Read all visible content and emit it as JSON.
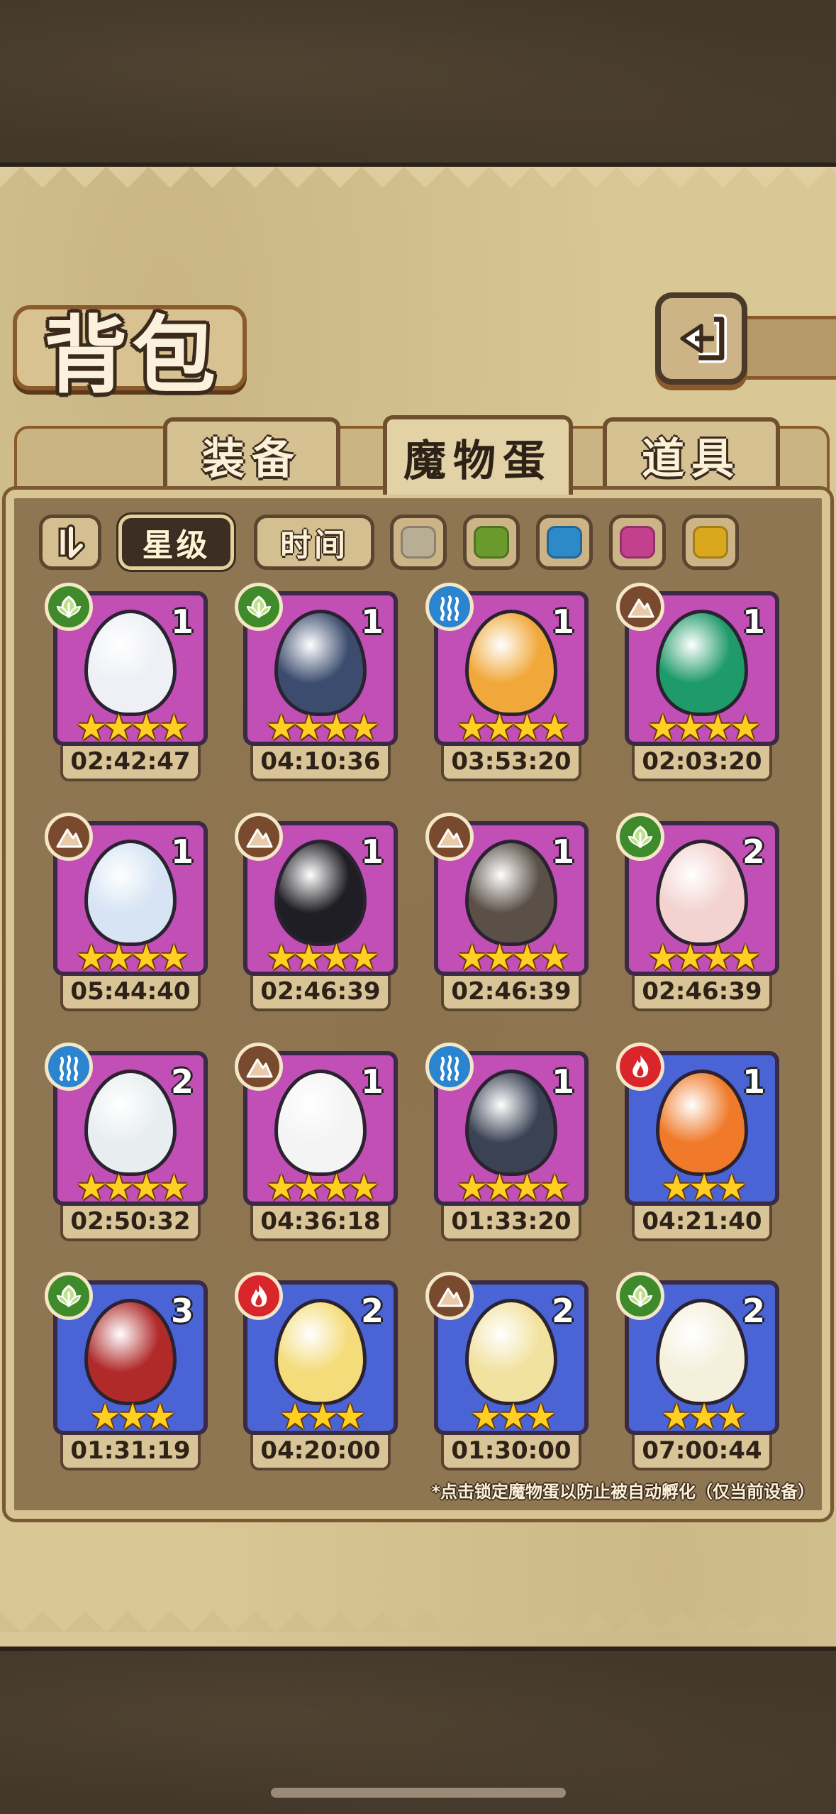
{
  "title": "背包",
  "tabs": [
    {
      "label": "装备",
      "active": false
    },
    {
      "label": "魔物蛋",
      "active": true
    },
    {
      "label": "道具",
      "active": false
    }
  ],
  "filters": {
    "sort_icon": "sort-toggle-icon",
    "star_label": "星级",
    "time_label": "时间",
    "color_swatches": [
      "#b8ad95",
      "#6a9a2c",
      "#2d8ac8",
      "#c2408e",
      "#d9a81c"
    ]
  },
  "elements": {
    "grass": {
      "icon": "leaf-icon",
      "color": "#3f8a2a"
    },
    "water": {
      "icon": "water-wave-icon",
      "color": "#2a84cf"
    },
    "earth": {
      "icon": "mountain-icon",
      "color": "#7a4a2e"
    },
    "fire": {
      "icon": "flame-icon",
      "color": "#d8262b"
    }
  },
  "eggs": [
    {
      "element": "grass",
      "count": "1",
      "stars": 4,
      "timer": "02:42:47",
      "rarity": "purple",
      "egg_color": "#eef0f6"
    },
    {
      "element": "grass",
      "count": "1",
      "stars": 4,
      "timer": "04:10:36",
      "rarity": "purple",
      "egg_color": "#3b4c6e"
    },
    {
      "element": "water",
      "count": "1",
      "stars": 4,
      "timer": "03:53:20",
      "rarity": "purple",
      "egg_color": "#f0a83a"
    },
    {
      "element": "earth",
      "count": "1",
      "stars": 4,
      "timer": "02:03:20",
      "rarity": "purple",
      "egg_color": "#1f9a6a"
    },
    {
      "element": "earth",
      "count": "1",
      "stars": 4,
      "timer": "05:44:40",
      "rarity": "purple",
      "egg_color": "#d6e4f4"
    },
    {
      "element": "earth",
      "count": "1",
      "stars": 4,
      "timer": "02:46:39",
      "rarity": "purple",
      "egg_color": "#1e1e24"
    },
    {
      "element": "earth",
      "count": "1",
      "stars": 4,
      "timer": "02:46:39",
      "rarity": "purple",
      "egg_color": "#5a5048"
    },
    {
      "element": "grass",
      "count": "2",
      "stars": 4,
      "timer": "02:46:39",
      "rarity": "purple",
      "egg_color": "#f3d2cf"
    },
    {
      "element": "water",
      "count": "2",
      "stars": 4,
      "timer": "02:50:32",
      "rarity": "purple",
      "egg_color": "#e8eef0"
    },
    {
      "element": "earth",
      "count": "1",
      "stars": 4,
      "timer": "04:36:18",
      "rarity": "purple",
      "egg_color": "#f4f4f4"
    },
    {
      "element": "water",
      "count": "1",
      "stars": 4,
      "timer": "01:33:20",
      "rarity": "purple",
      "egg_color": "#3a4254"
    },
    {
      "element": "fire",
      "count": "1",
      "stars": 3,
      "timer": "04:21:40",
      "rarity": "blue",
      "egg_color": "#f07a2a"
    },
    {
      "element": "grass",
      "count": "3",
      "stars": 3,
      "timer": "01:31:19",
      "rarity": "blue",
      "egg_color": "#b02a2a"
    },
    {
      "element": "fire",
      "count": "2",
      "stars": 3,
      "timer": "04:20:00",
      "rarity": "blue",
      "egg_color": "#f4dc7a"
    },
    {
      "element": "earth",
      "count": "2",
      "stars": 3,
      "timer": "01:30:00",
      "rarity": "blue",
      "egg_color": "#f2e2a0"
    },
    {
      "element": "grass",
      "count": "2",
      "stars": 3,
      "timer": "07:00:44",
      "rarity": "blue",
      "egg_color": "#f4f0dc"
    }
  ],
  "rarity_colors": {
    "purple": "#c24fb6",
    "blue": "#4a64d6"
  },
  "footnote": "*点击锁定魔物蛋以防止被自动孵化（仅当前设备）"
}
